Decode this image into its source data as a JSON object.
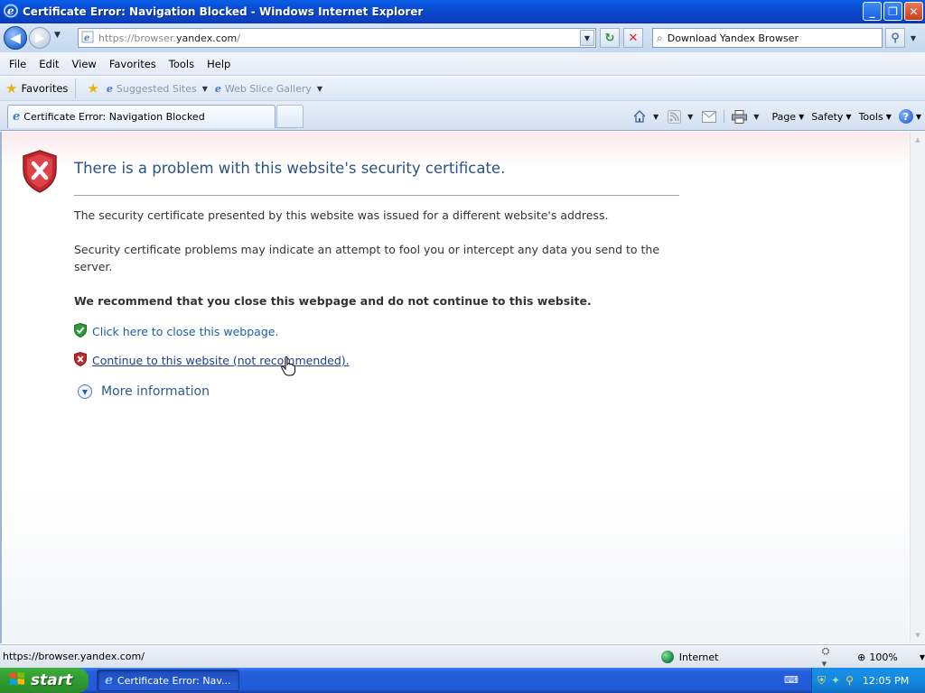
{
  "window": {
    "title": "Certificate Error: Navigation Blocked - Windows Internet Explorer",
    "minimize_label": "_",
    "restore_label": "❐",
    "close_label": "✕"
  },
  "address_bar": {
    "url_prefix": "https://browser.",
    "url_domain": "yandex.com",
    "url_suffix": "/",
    "search_text": "Download Yandex Browser"
  },
  "menu": {
    "items": [
      "File",
      "Edit",
      "View",
      "Favorites",
      "Tools",
      "Help"
    ]
  },
  "favorites_bar": {
    "favorites_label": "Favorites",
    "links": [
      "Suggested Sites",
      "Web Slice Gallery"
    ]
  },
  "tabs": {
    "active_label": "Certificate Error: Navigation Blocked"
  },
  "command_bar": {
    "page_label": "Page",
    "safety_label": "Safety",
    "tools_label": "Tools"
  },
  "page": {
    "title": "There is a problem with this website's security certificate.",
    "paragraph1": "The security certificate presented by this website was issued for a different website's address.",
    "paragraph2": "Security certificate problems may indicate an attempt to fool you or intercept any data you send to the server.",
    "recommendation": "We recommend that you close this webpage and do not continue to this website.",
    "close_link": "Click here to close this webpage.",
    "continue_link": "Continue to this website (not recommended).",
    "more_info": "More information"
  },
  "status_bar": {
    "url": "https://browser.yandex.com/",
    "zone": "Internet",
    "zoom": "100%"
  },
  "taskbar": {
    "start_label": "start",
    "task_label": "Certificate Error: Nav...",
    "clock": "12:05 PM"
  },
  "colors": {
    "title_blue": "#2c5282",
    "link_blue": "#1c5fa6",
    "shield_red": "#c0282d",
    "shield_green": "#2f9a3a"
  }
}
